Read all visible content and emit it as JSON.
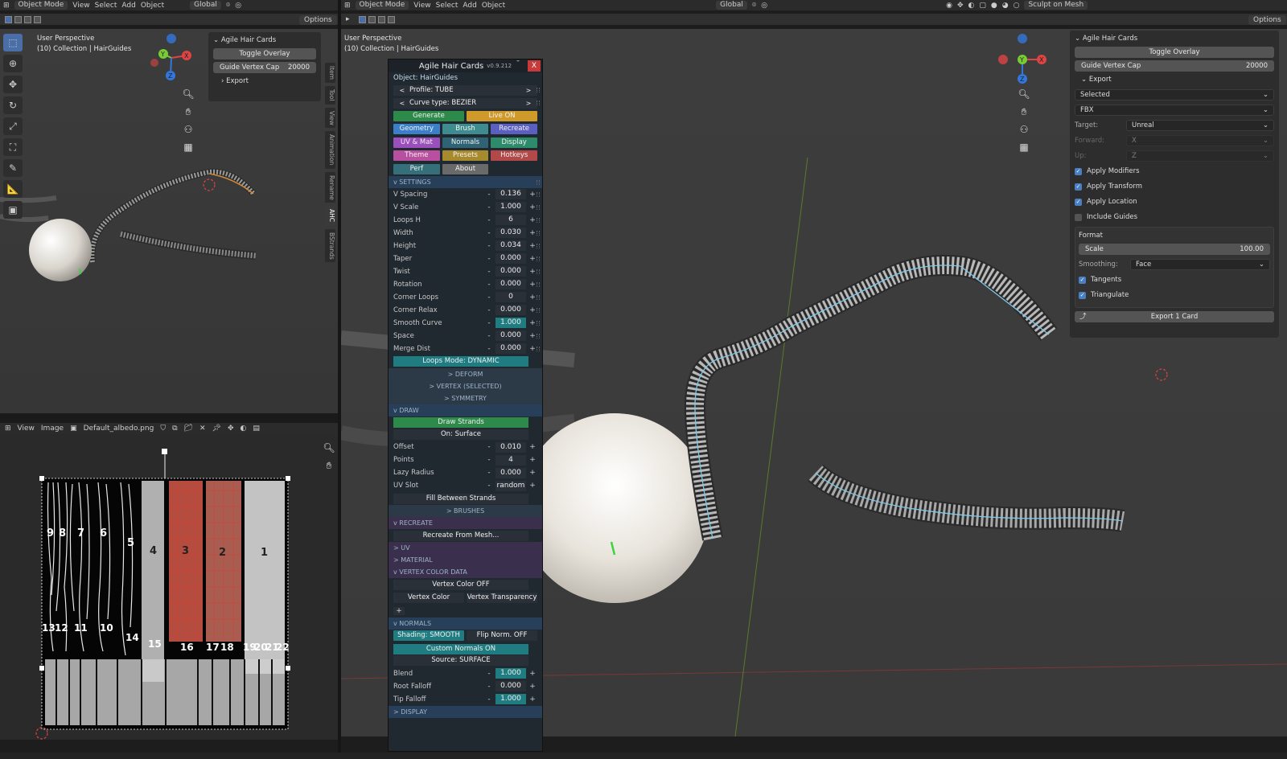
{
  "top_left_header": {
    "mode": "Object Mode",
    "menus": [
      "View",
      "Select",
      "Add",
      "Object"
    ],
    "orientation": "Global",
    "options": "Options"
  },
  "top_main_header": {
    "mode": "Object Mode",
    "menus": [
      "View",
      "Select",
      "Add",
      "Object"
    ],
    "orientation": "Global",
    "options": "Options",
    "workspace": "Sculpt on Mesh"
  },
  "left_viewport": {
    "perspective": "User Perspective",
    "collection": "(10) Collection | HairGuides",
    "side_tabs": [
      "Item",
      "Tool",
      "View",
      "Animation",
      "Rename",
      "AHC",
      "BStrands"
    ],
    "npanel": {
      "title": "Agile Hair Cards",
      "toggle_overlay": "Toggle Overlay",
      "guide_cap_label": "Guide Vertex Cap",
      "guide_cap_value": "20000",
      "export_label": "Export"
    }
  },
  "main_viewport": {
    "perspective": "User Perspective",
    "collection": "(10) Collection | HairGuides"
  },
  "right_npanel": {
    "title": "Agile Hair Cards",
    "toggle_overlay": "Toggle Overlay",
    "guide_cap_label": "Guide Vertex Cap",
    "guide_cap_value": "20000",
    "export_label": "Export",
    "selection": "Selected",
    "file_format": "FBX",
    "target_label": "Target:",
    "target_value": "Unreal",
    "forward_label": "Forward:",
    "forward_value": "X",
    "up_label": "Up:",
    "up_value": "Z",
    "apply_modifiers": "Apply Modifiers",
    "apply_transform": "Apply Transform",
    "apply_location": "Apply Location",
    "include_guides": "Include Guides",
    "format_label": "Format",
    "scale_label": "Scale",
    "scale_value": "100.00",
    "smoothing_label": "Smoothing:",
    "smoothing_value": "Face",
    "tangents": "Tangents",
    "triangulate": "Triangulate",
    "export_button": "Export 1 Card"
  },
  "ahc_panel": {
    "title": "Agile Hair Cards",
    "version": "v0.9.212",
    "object": "Object: HairGuides",
    "profile": "Profile:  TUBE",
    "curve_type": "Curve type:  BEZIER",
    "generate": "Generate",
    "live": "Live ON",
    "tabs": [
      {
        "label": "Geometry",
        "color": "#3a7fc8"
      },
      {
        "label": "Brush",
        "color": "#3e8c8f"
      },
      {
        "label": "Recreate",
        "color": "#5a5fc0"
      },
      {
        "label": "UV & Mat",
        "color": "#9b4fbc"
      },
      {
        "label": "Normals",
        "color": "#2f6373"
      },
      {
        "label": "Display",
        "color": "#2d8a6b"
      },
      {
        "label": "Theme",
        "color": "#b8509f"
      },
      {
        "label": "Presets",
        "color": "#a88a2e"
      },
      {
        "label": "Hotkeys",
        "color": "#b24848"
      },
      {
        "label": "Perf",
        "color": "#356f7a"
      },
      {
        "label": "About",
        "color": "#6a6a6a"
      }
    ],
    "settings_header": "v SETTINGS",
    "settings": [
      {
        "label": "V Spacing",
        "value": "0.136"
      },
      {
        "label": "V Scale",
        "value": "1.000"
      },
      {
        "label": "Loops H",
        "value": "6"
      },
      {
        "label": "Width",
        "value": "0.030"
      },
      {
        "label": "Height",
        "value": "0.034"
      },
      {
        "label": "Taper",
        "value": "0.000"
      },
      {
        "label": "Twist",
        "value": "0.000"
      },
      {
        "label": "Rotation",
        "value": "0.000"
      },
      {
        "label": "Corner Loops",
        "value": "0"
      },
      {
        "label": "Corner Relax",
        "value": "0.000"
      },
      {
        "label": "Smooth Curve",
        "value": "1.000"
      },
      {
        "label": "Space",
        "value": "0.000"
      },
      {
        "label": "Merge Dist",
        "value": "0.000"
      }
    ],
    "loops_mode": "Loops Mode: DYNAMIC",
    "deform": "> DEFORM",
    "vertex_selected": "> VERTEX (SELECTED)",
    "symmetry": "> SYMMETRY",
    "draw_header": "v DRAW",
    "draw_strands": "Draw Strands",
    "on_surface": "On: Surface",
    "draw_fields": [
      {
        "label": "Offset",
        "value": "0.010"
      },
      {
        "label": "Points",
        "value": "4"
      },
      {
        "label": "Lazy Radius",
        "value": "0.000"
      },
      {
        "label": "UV Slot",
        "value": "random"
      }
    ],
    "fill_between": "Fill Between Strands",
    "brushes": "> BRUSHES",
    "recreate_header": "v RECREATE",
    "recreate_from_mesh": "Recreate From Mesh...",
    "uv": "> UV",
    "material": "> MATERIAL",
    "vcol_header": "v VERTEX COLOR DATA",
    "vcol_off": "Vertex Color OFF",
    "vertex_color": "Vertex Color",
    "vertex_transparency": "Vertex Transparency",
    "plus": "+",
    "normals_header": "v NORMALS",
    "shading": "Shading: SMOOTH",
    "flip_norm": "Flip Norm. OFF",
    "custom_normals": "Custom Normals ON",
    "source": "Source: SURFACE",
    "normal_fields": [
      {
        "label": "Blend",
        "value": "1.000"
      },
      {
        "label": "Root Falloff",
        "value": "0.000"
      },
      {
        "label": "Tip Falloff",
        "value": "1.000"
      }
    ],
    "display": "> DISPLAY"
  },
  "image_editor": {
    "menus": [
      "View",
      "Image"
    ],
    "image_name": "Default_albedo.png",
    "card_labels_top": [
      "9",
      "8",
      "7",
      "6",
      "5",
      "4",
      "3",
      "2",
      "1"
    ],
    "card_labels_bottom": [
      "13",
      "12",
      "11",
      "10",
      "14",
      "15",
      "16",
      "17",
      "18",
      "19",
      "20",
      "21",
      "22"
    ]
  }
}
